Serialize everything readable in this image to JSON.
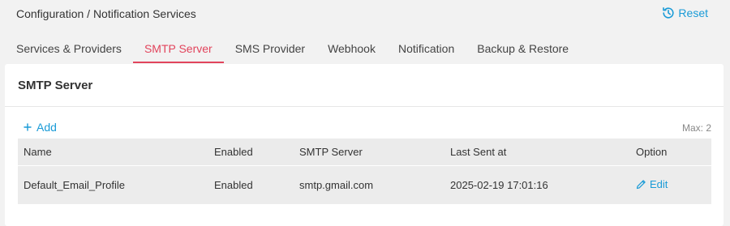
{
  "header": {
    "breadcrumb": "Configuration / Notification Services",
    "reset_label": "Reset"
  },
  "tabs": [
    {
      "label": "Services & Providers"
    },
    {
      "label": "SMTP Server",
      "active": true
    },
    {
      "label": "SMS Provider"
    },
    {
      "label": "Webhook"
    },
    {
      "label": "Notification"
    },
    {
      "label": "Backup & Restore"
    }
  ],
  "card": {
    "title": "SMTP Server",
    "add_label": "Add",
    "max_label": "Max: 2"
  },
  "table": {
    "columns": [
      "Name",
      "Enabled",
      "SMTP Server",
      "Last Sent at",
      "Option"
    ],
    "rows": [
      {
        "name": "Default_Email_Profile",
        "enabled": "Enabled",
        "smtp_server": "smtp.gmail.com",
        "last_sent": "2025-02-19 17:01:16",
        "option": "Edit"
      }
    ]
  },
  "colors": {
    "accent": "#1a9bd7",
    "active_tab": "#e2445c",
    "background": "#f2f2f2"
  },
  "icons": {
    "reset": "history-icon",
    "add": "plus-icon",
    "edit": "pencil-icon"
  }
}
